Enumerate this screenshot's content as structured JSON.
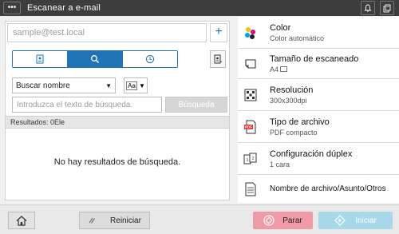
{
  "topbar": {
    "menu_icon": "ellipsis-icon",
    "title": "Escanear a e-mail",
    "icons": [
      "bell-icon",
      "device-icon"
    ]
  },
  "address": {
    "placeholder": "sample@test.local",
    "add_icon": "plus-icon",
    "add_label": "+"
  },
  "tabs": [
    {
      "icon": "address-book-icon",
      "active": false
    },
    {
      "icon": "search-icon",
      "active": true
    },
    {
      "icon": "clock-icon",
      "active": false
    }
  ],
  "search": {
    "select_value": "Buscar nombre",
    "case_label": "Aa",
    "query_placeholder": "Introduzca el texto de búsqueda.",
    "search_button": "Búsqueda"
  },
  "results": {
    "label": "Resultados: 0Ele",
    "empty_message": "No hay resultados de búsqueda."
  },
  "settings": [
    {
      "title": "Color",
      "value": "Color automático",
      "icon": "color-dots-icon"
    },
    {
      "title": "Tamaño de escaneado",
      "value": "A4",
      "icon": "paper-size-icon"
    },
    {
      "title": "Resolución",
      "value": "300x300dpi",
      "icon": "resolution-icon"
    },
    {
      "title": "Tipo de archivo",
      "value": "PDF compacto",
      "icon": "pdf-file-icon"
    },
    {
      "title": "Configuración dúplex",
      "value": "1 cara",
      "icon": "duplex-icon"
    },
    {
      "title": "Nombre de archivo/Asunto/Otros",
      "value": "",
      "icon": "document-icon"
    }
  ],
  "bottom": {
    "home_icon": "home-icon",
    "reset_label": "Reiniciar",
    "stop_label": "Parar",
    "start_label": "Iniciar"
  },
  "colors": {
    "accent": "#1f73b7",
    "stop": "#f09aa8",
    "start": "#a7d8ea",
    "topbar": "#3d3d3d"
  }
}
